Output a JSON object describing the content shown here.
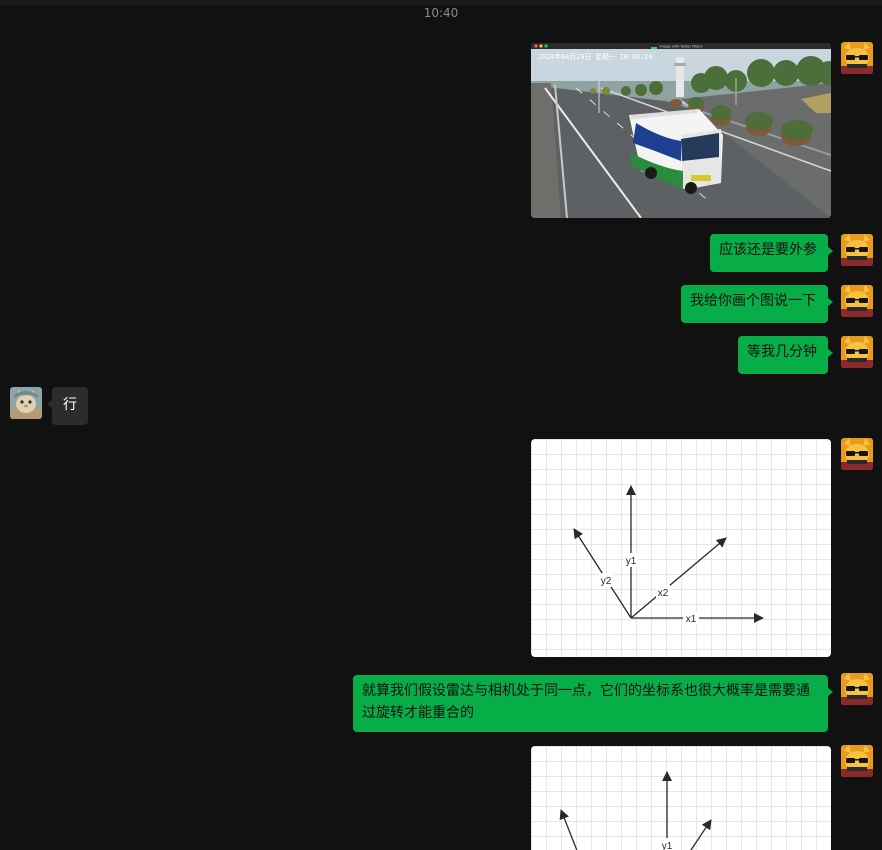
{
  "timestamp": "10:40",
  "colors": {
    "background": "#111111",
    "my_bubble": "#07ad46",
    "their_bubble": "#2c2c2c"
  },
  "messages": {
    "m2": "应该还是要外参",
    "m3": "我给你画个图说一下",
    "m4": "等我几分钟",
    "m5": "行",
    "m7": "就算我们假设雷达与相机处于同一点，它们的坐标系也很大概率是需要通过旋转才能重合的"
  },
  "photo": {
    "window_title": "image with faster filters",
    "camera_overlay": "2024年04月29日  星期一  10:06:24"
  },
  "diagram1": {
    "x1": "x1",
    "y1": "y1",
    "x2": "x2",
    "y2": "y2"
  },
  "diagram2": {
    "y1": "y1"
  }
}
